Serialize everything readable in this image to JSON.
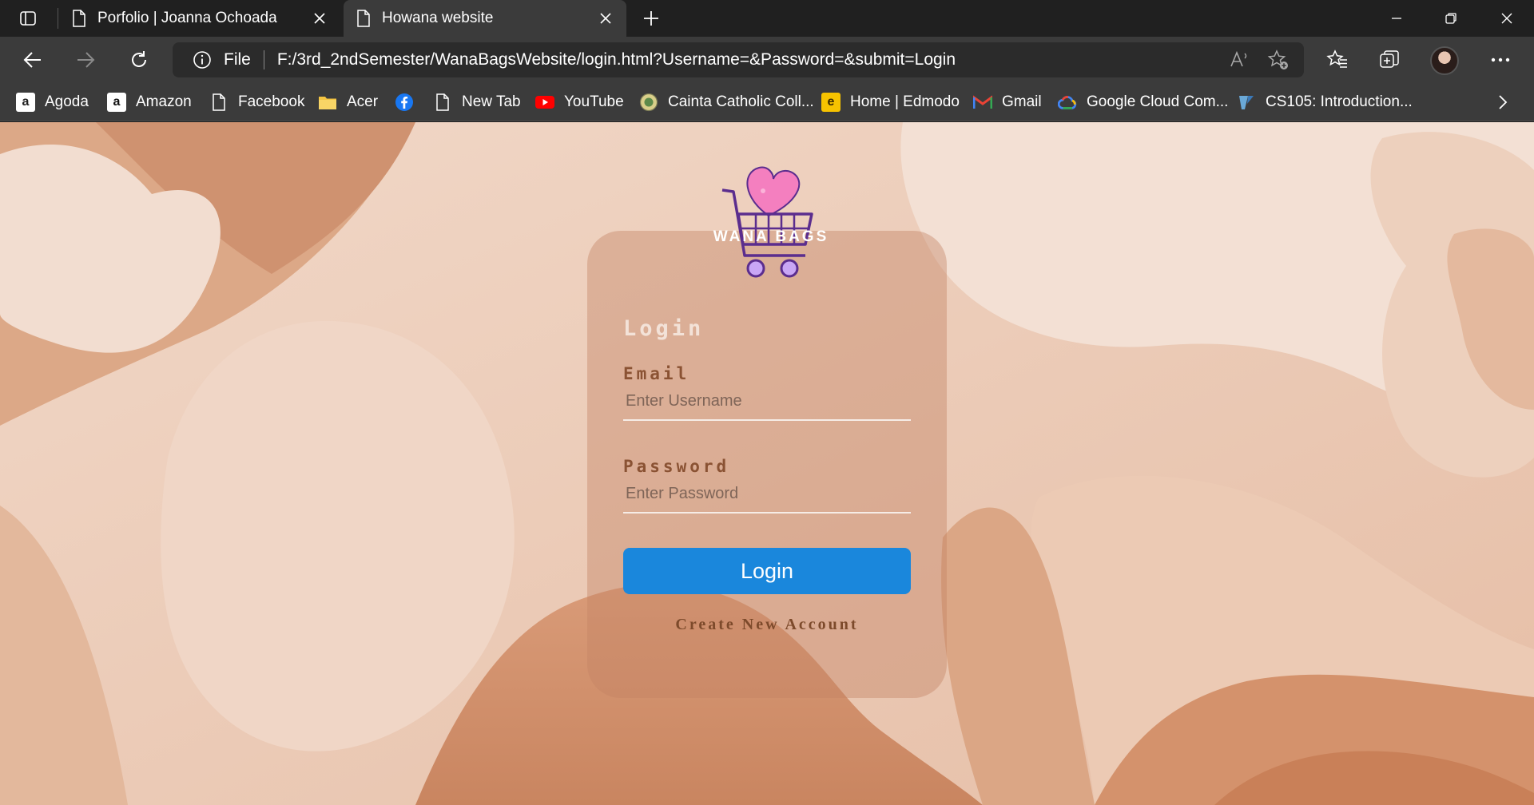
{
  "browser": {
    "tabs": [
      {
        "title": "Porfolio | Joanna Ochoada",
        "active": false
      },
      {
        "title": "Howana website",
        "active": true
      }
    ],
    "address": {
      "scheme_label": "File",
      "url": "F:/3rd_2ndSemester/WanaBagsWebsite/login.html?Username=&Password=&submit=Login"
    },
    "bookmarks": [
      {
        "label": "Agoda",
        "icon": "agoda-icon"
      },
      {
        "label": "Amazon",
        "icon": "amazon-icon"
      },
      {
        "label": "Facebook",
        "icon": "page-icon"
      },
      {
        "label": "Acer",
        "icon": "folder-icon"
      },
      {
        "label": "",
        "icon": "facebook-icon"
      },
      {
        "label": "New Tab",
        "icon": "page-icon"
      },
      {
        "label": "YouTube",
        "icon": "youtube-icon"
      },
      {
        "label": "Cainta Catholic Coll...",
        "icon": "school-seal-icon"
      },
      {
        "label": "Home | Edmodo",
        "icon": "edmodo-icon"
      },
      {
        "label": "Gmail",
        "icon": "gmail-icon"
      },
      {
        "label": "Google Cloud Com...",
        "icon": "google-cloud-icon"
      },
      {
        "label": "CS105: Introduction...",
        "icon": "course-icon"
      }
    ]
  },
  "page": {
    "brand": "WANA BAGS",
    "title": "Login",
    "email_label": "Email",
    "email_placeholder": "Enter Username",
    "password_label": "Password",
    "password_placeholder": "Enter Password",
    "login_button": "Login",
    "create_account": "Create New Account"
  },
  "colors": {
    "background": "#edcfbe",
    "accent_button": "#1a87dc",
    "label_brown": "#8a5233",
    "logo_heart": "#f47fbf",
    "logo_cart": "#5b2d8e"
  }
}
